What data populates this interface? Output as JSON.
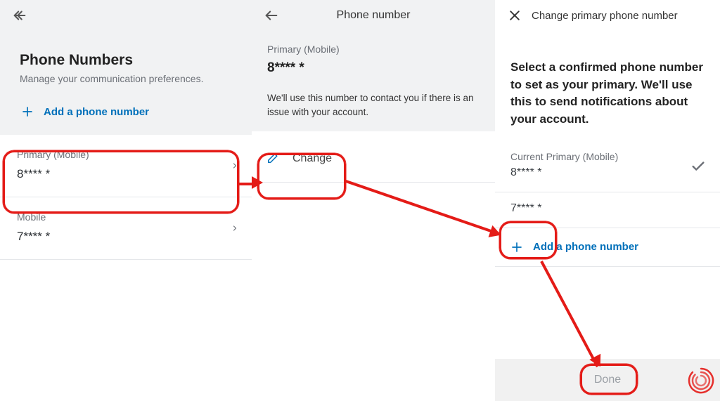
{
  "left": {
    "title": "Phone Numbers",
    "subtitle": "Manage your communication preferences.",
    "add_label": "Add a phone number",
    "items": [
      {
        "label": "Primary (Mobile)",
        "value": "8**** *"
      },
      {
        "label": "Mobile",
        "value": "7**** *"
      }
    ]
  },
  "mid": {
    "header_title": "Phone number",
    "primary_label": "Primary (Mobile)",
    "primary_value": "8**** *",
    "description": "We'll use this number to contact you if there is an issue with your account.",
    "change_label": "Change"
  },
  "right": {
    "header_title": "Change primary phone number",
    "instruction": "Select a confirmed phone number to set as your primary. We'll use this to send notifications about your account.",
    "current_label": "Current Primary (Mobile)",
    "current_value": "8**** *",
    "alternate_value": "7**** *",
    "add_label": "Add a phone number",
    "done_label": "Done"
  }
}
